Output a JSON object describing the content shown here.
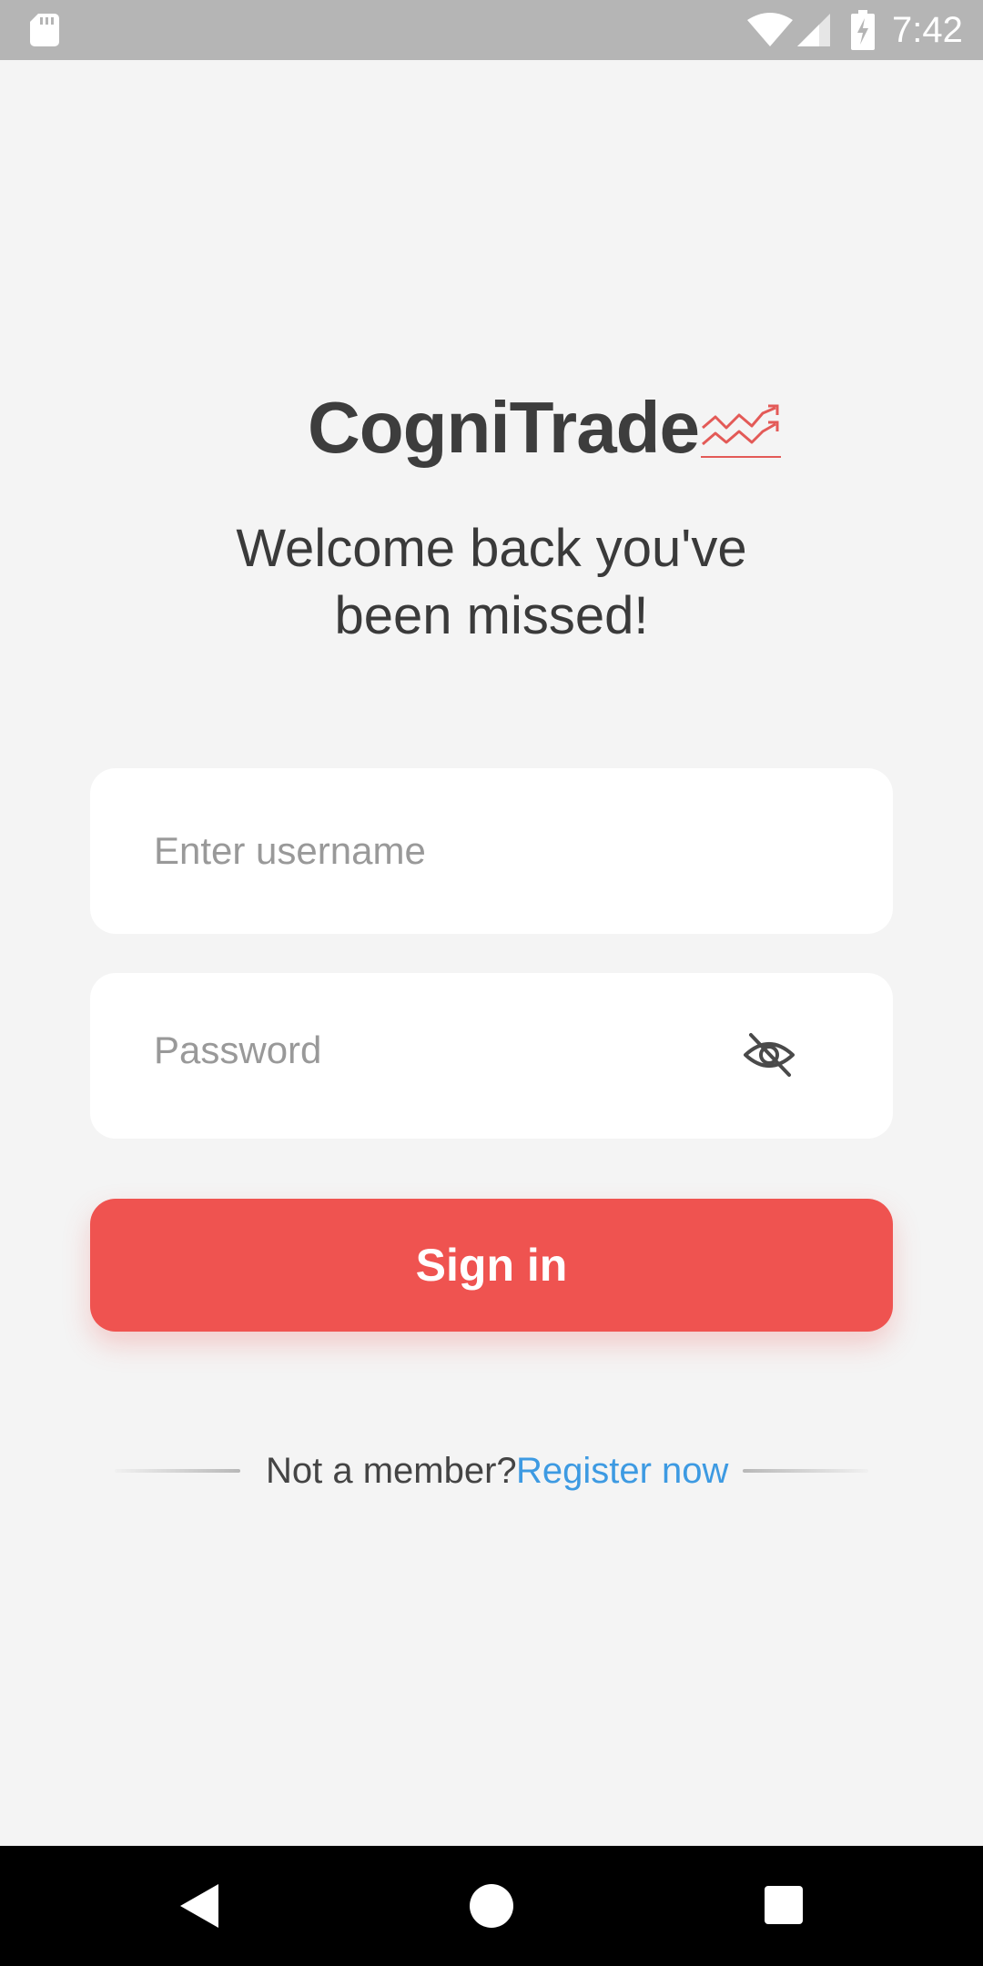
{
  "status_bar": {
    "time": "7:42",
    "icons": [
      "sd-card-icon",
      "wifi-icon",
      "signal-icon",
      "battery-charging-icon"
    ]
  },
  "brand": {
    "name": "CogniTrade",
    "icon": "trending-chart-icon",
    "accent_color": "#ef5350"
  },
  "welcome": {
    "line1": "Welcome back you've",
    "line2": "been missed!"
  },
  "form": {
    "username": {
      "placeholder": "Enter username",
      "value": ""
    },
    "password": {
      "placeholder": "Password",
      "value": "",
      "toggle_icon": "eye-off-icon"
    },
    "sign_in_label": "Sign in",
    "sign_in_color": "#ef5350"
  },
  "register": {
    "prompt": "Not a member?",
    "link_label": "Register now",
    "link_color": "#3d9ae2"
  },
  "nav_bar": {
    "icons": [
      "back-icon",
      "home-icon",
      "recents-icon"
    ]
  }
}
